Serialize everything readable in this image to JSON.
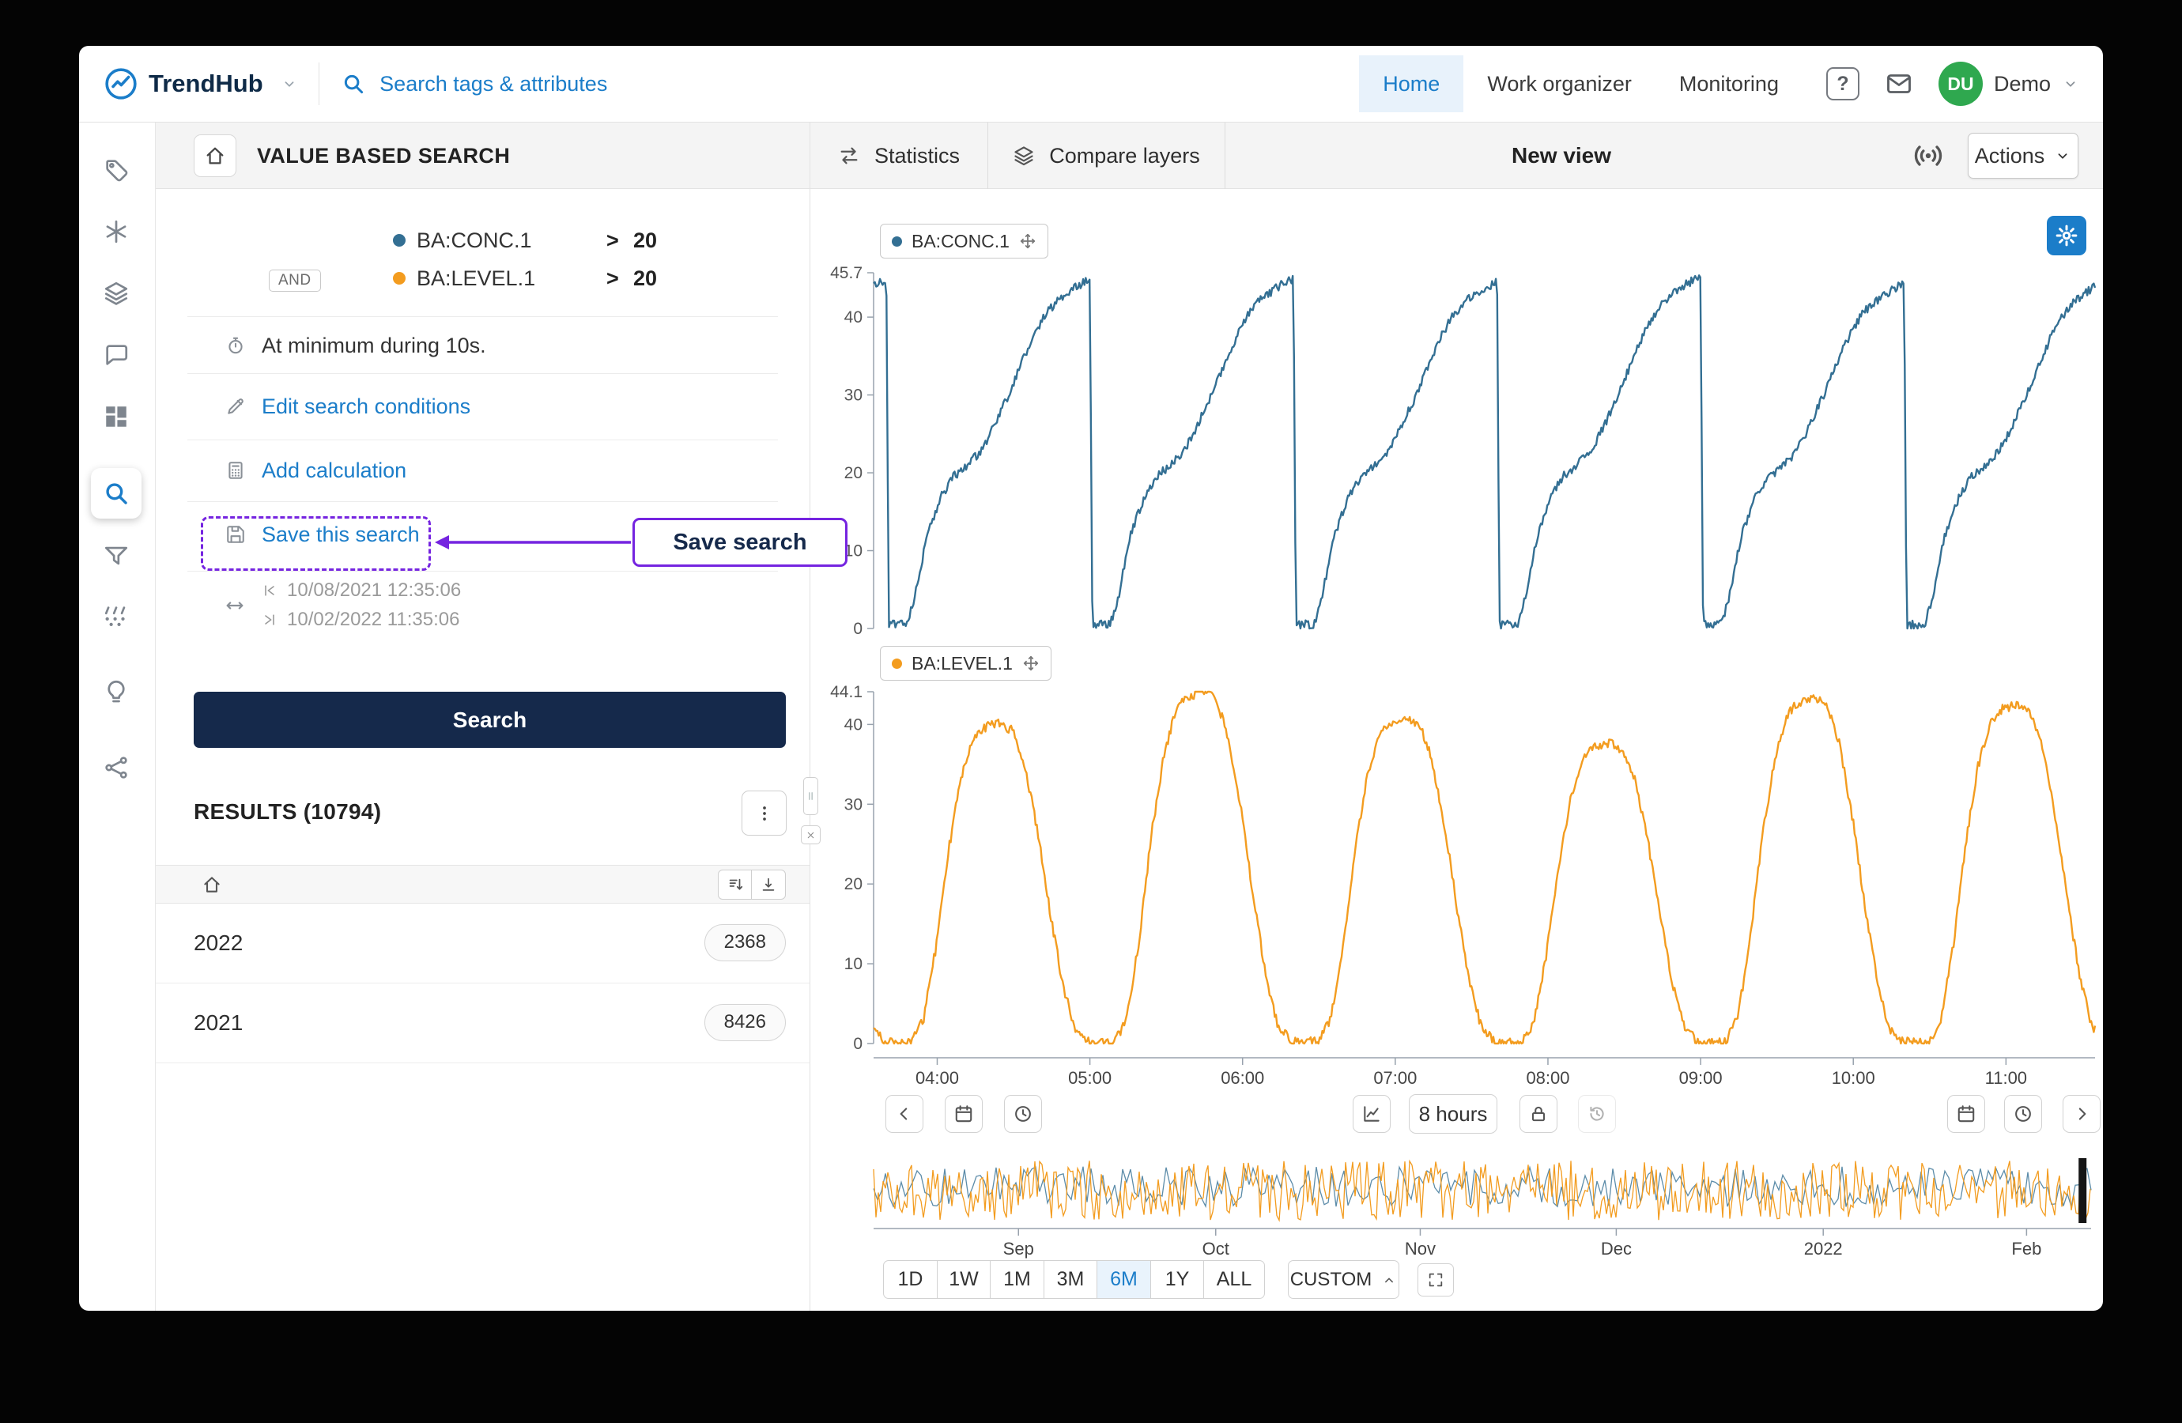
{
  "header": {
    "brand": "TrendHub",
    "search_placeholder": "Search tags & attributes",
    "nav": [
      {
        "label": "Home",
        "active": true
      },
      {
        "label": "Work organizer",
        "active": false
      },
      {
        "label": "Monitoring",
        "active": false
      }
    ],
    "help": "?",
    "avatar": "DU",
    "account": "Demo"
  },
  "sidebar_icons": [
    "tags",
    "assets",
    "layers",
    "annotations",
    "dashboards",
    "search",
    "filters",
    "sensor-data",
    "recommendations",
    "models"
  ],
  "search_panel": {
    "title": "VALUE BASED SEARCH",
    "conjunction": "AND",
    "conditions": [
      {
        "tag": "BA:CONC.1",
        "operator": ">",
        "value": "20",
        "color": "#336f93"
      },
      {
        "tag": "BA:LEVEL.1",
        "operator": ">",
        "value": "20",
        "color": "#f39c1f"
      }
    ],
    "duration": "At minimum during 10s.",
    "edit_link": "Edit search conditions",
    "calc_link": "Add calculation",
    "save_link": "Save this search",
    "time_from": "10/08/2021 12:35:06",
    "time_to": "10/02/2022 11:35:06",
    "search_button": "Search",
    "results_title": "RESULTS (10794)",
    "results": [
      {
        "label": "2022",
        "count": "2368"
      },
      {
        "label": "2021",
        "count": "8426"
      }
    ]
  },
  "annotation": {
    "label": "Save search",
    "color": "#7524e0"
  },
  "view_bar": {
    "statistics": "Statistics",
    "compare_layers": "Compare layers",
    "title": "New view",
    "actions": "Actions"
  },
  "controls": {
    "window_label": "8 hours"
  },
  "range_bar": {
    "buttons": [
      "1D",
      "1W",
      "1M",
      "3M",
      "6M",
      "1Y",
      "ALL"
    ],
    "active": "6M",
    "custom": "CUSTOM"
  },
  "x_axis": {
    "start_hours": 3.5833,
    "end_hours": 11.5833,
    "ticks": [
      {
        "t": 4,
        "label": "04:00"
      },
      {
        "t": 5,
        "label": "05:00"
      },
      {
        "t": 6,
        "label": "06:00"
      },
      {
        "t": 7,
        "label": "07:00"
      },
      {
        "t": 8,
        "label": "08:00"
      },
      {
        "t": 9,
        "label": "09:00"
      },
      {
        "t": 10,
        "label": "10:00"
      },
      {
        "t": 11,
        "label": "11:00"
      }
    ]
  },
  "chart_data": [
    {
      "type": "line",
      "name": "BA:CONC.1",
      "color": "#336f93",
      "ymax": 45.7,
      "ytop_label": "45.7",
      "yticks": [
        0,
        10,
        20,
        30,
        40
      ],
      "period_hours": 1.3333,
      "cycle_origin_hours": 3.6667,
      "noise": 0.55,
      "seed": 11,
      "cycle_amplitudes": [
        1,
        1.005,
        0.995,
        1.01,
        0.99,
        1
      ],
      "cycle_shape": [
        [
          0,
          44.8
        ],
        [
          0.012,
          0.5
        ],
        [
          0.1,
          0.5
        ],
        [
          0.14,
          4
        ],
        [
          0.2,
          12
        ],
        [
          0.27,
          17
        ],
        [
          0.33,
          19.5
        ],
        [
          0.4,
          21
        ],
        [
          0.47,
          23
        ],
        [
          0.53,
          26
        ],
        [
          0.6,
          30
        ],
        [
          0.67,
          34.5
        ],
        [
          0.74,
          38.5
        ],
        [
          0.8,
          41
        ],
        [
          0.86,
          42.5
        ],
        [
          0.93,
          43.8
        ],
        [
          1,
          44.8
        ]
      ]
    },
    {
      "type": "line",
      "name": "BA:LEVEL.1",
      "color": "#f39c1f",
      "ymax": 44.1,
      "ytop_label": "44.1",
      "yticks": [
        0,
        10,
        20,
        30,
        40
      ],
      "period_hours": 1.3333,
      "cycle_origin_hours": 3.75,
      "noise": 0.6,
      "seed": 37,
      "cycle_amplitudes": [
        0.99,
        1.09,
        1.01,
        0.93,
        1.07,
        1.05
      ],
      "cycle_shape": [
        [
          0,
          0.2
        ],
        [
          0.06,
          0.2
        ],
        [
          0.12,
          3
        ],
        [
          0.18,
          12
        ],
        [
          0.24,
          24
        ],
        [
          0.3,
          33
        ],
        [
          0.36,
          38.5
        ],
        [
          0.42,
          40
        ],
        [
          0.5,
          40.5
        ],
        [
          0.56,
          39.5
        ],
        [
          0.62,
          35
        ],
        [
          0.68,
          27
        ],
        [
          0.74,
          17
        ],
        [
          0.8,
          8
        ],
        [
          0.86,
          2
        ],
        [
          0.93,
          0.2
        ],
        [
          1,
          0.2
        ]
      ]
    }
  ],
  "overview": {
    "ticks": [
      {
        "label": "Sep",
        "f": 0.119
      },
      {
        "label": "Oct",
        "f": 0.281
      },
      {
        "label": "Nov",
        "f": 0.449
      },
      {
        "label": "Dec",
        "f": 0.61
      },
      {
        "label": "2022",
        "f": 0.78
      },
      {
        "label": "Feb",
        "f": 0.947
      }
    ],
    "selection": {
      "f": 0.993,
      "w": 10
    }
  }
}
